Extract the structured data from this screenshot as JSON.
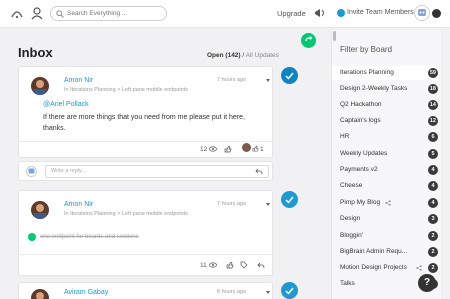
{
  "topbar": {
    "search_placeholder": "Search Everything ...",
    "upgrade_label": "Upgrade",
    "invite_label": "Invite Team Members"
  },
  "inbox": {
    "title": "Inbox",
    "open_label": "Open (142)",
    "separator": " / ",
    "all_label": "All Updates"
  },
  "posts": [
    {
      "author": "Amon Nir",
      "board": "In Iterations Planning > Left pane mobile endpoints",
      "time": "7 hours ago",
      "mention": "@Ariel Pollack",
      "lines": [
        "If there are more things that you need from me please put it here,",
        "thanks."
      ],
      "views": "12",
      "likes": "1"
    },
    {
      "author": "Amon Nir",
      "board": "In Iterations Planning > Left pane mobile endpoints",
      "time": "7 hours ago",
      "done_text": "one endpoint for boards and sections",
      "views": "11"
    },
    {
      "author": "Aviram Gabay",
      "time": "8 hours ago"
    }
  ],
  "reply": {
    "placeholder": "Write a reply..."
  },
  "sidebar": {
    "title": "Filter by Board",
    "boards": [
      {
        "label": "Iterations Planning",
        "count": "59"
      },
      {
        "label": "Design 2-Weekly Tasks",
        "count": "18"
      },
      {
        "label": "Q2 Hackathon",
        "count": "14"
      },
      {
        "label": "Captain's logs",
        "count": "12"
      },
      {
        "label": "HR",
        "count": "6"
      },
      {
        "label": "Weekly Updates",
        "count": "5"
      },
      {
        "label": "Payments v2",
        "count": "4"
      },
      {
        "label": "Cheese",
        "count": "4"
      },
      {
        "label": "Pimp My Blog",
        "count": "4"
      },
      {
        "label": "Design",
        "count": "3"
      },
      {
        "label": "Bloggin'",
        "count": "2"
      },
      {
        "label": "BigBrain Admin Requ...",
        "count": "2"
      },
      {
        "label": "Motion Design Projects",
        "count": "2"
      },
      {
        "label": "Talks",
        "count": "2"
      }
    ]
  },
  "help_label": "?",
  "colors": {
    "accent": "#1d9bd1",
    "green": "#00c875",
    "dark": "#333333"
  }
}
